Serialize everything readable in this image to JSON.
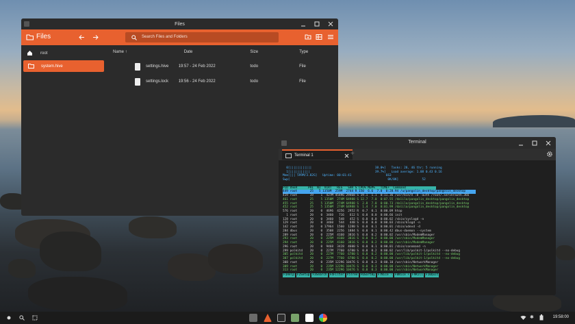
{
  "files": {
    "window_title": "Files",
    "app_title": "Files",
    "search_placeholder": "Search Files and Folders",
    "sidebar": [
      {
        "label": "root"
      },
      {
        "label": "system.hive"
      }
    ],
    "columns": {
      "name": "Name ↑",
      "date": "Date",
      "size": "Size",
      "type": "Type"
    },
    "rows": [
      {
        "name": "settings.hive",
        "date": "19:57 - 24 Feb 2022",
        "size": "todo",
        "type": "File"
      },
      {
        "name": "settings.lock",
        "date": "19:56 - 24 Feb 2022",
        "size": "todo",
        "type": "File"
      }
    ]
  },
  "terminal": {
    "window_title": "Terminal",
    "tab_label": "Terminal 1",
    "meters": [
      "  0[||||||||||||                                   38.0%]   Tasks: 28, 46 thr; 5 running",
      "  1[|||||||||||                                    39.7%]   Load average: 1.08 0.43 0.16",
      "Mem[||| 599M/3.82G]   Uptime: 00:01:41                   663   ",
      "Swp[                                                      0K/0K]             52"
    ],
    "header": "PID USER      PRI  NI  VIRT   RES   SHR S CPU% MEM%   TIME+  Command",
    "selected": "449 root       25   5 1350M  259M  2744 R 150  6.6  7.0  0:28.94 /u/pangolin_desktop/pangolin_desktop",
    "procs": [
      "419 root       19    1  427M 45496 29468 S 19.1  1.1  0:11.36 /usr/bin/X :0 -auth /root/.serverauth.366",
      "461 root       25    5 1350M  274M 64988 S 12.7  7.0  0:07.55 /dalila/pangolin_desktop/pangolin_desktop",
      "455 root       25    5 1350M  274M 64988 S  2.8  7.0  0:00.73 /dalila/pangolin_desktop/pangolin_desktop",
      "452 root       25    5 1350M  274M 64988 S  1.4  7.0  0:01.99 /dalila/pangolin_desktop/pangolin_desktop",
      "576 root       20    0  4696  4256  2952 R  0.7  0.1  0:00.09 htop",
      "  1 root       20    0  3460   716   612 S  0.0  0.0  0:00.66 init",
      "128 root       20    0  3460   548   452 S  0.0  0.0  0:00.02 /sbin/syslogd -n",
      "129 root       20    0  3460   544   448 S  0.0  0.0  0:00.03 /sbin/klogd -n",
      "142 root       20    0 17964  1560  1280 S  0.0  0.1  0:00.01 /sbin/udevd -d",
      "284 dbus       20    0  3508  2256  1884 S  0.0  0.1  0:00.42 dbus-daemon --system",
      "289 root       20    0  225M  4160  3816 S  0.0  0.2  0:00.02 /usr/sbin/ModemManager",
      "293 root       20    0  225M  4160  3816 S  0.0  0.2  0:00.00 /usr/sbin/ModemManager",
      "294 root       20    0  225M  4160  3816 S  0.0  0.2  0:00.00 /usr/sbin/ModemManager",
      "296 root       20    0  9468  3428  4600 S  0.0  0.1  0:00.01 /sbin/connmand -n",
      "299 polkitd    20    0  227M  7760  6780 S  0.0  0.2  0:00.02 /usr/lib/polkit-1/polkitd --no-debug",
      "305 polkitd    20    0  227M  7760  6780 S  0.0  0.2  0:00.00 /usr/lib/polkit-1/polkitd --no-debug",
      "307 polkitd    20    0  227M  7760  6780 S  0.0  0.2  0:00.00 /usr/lib/polkit-1/polkitd --no-debug",
      "308 root       20    0  235M 12296 10476 S  0.0  0.3  0:00.10 /usr/sbin/NetworkManager",
      "309 root       20    0  235M 12296 10476 S  0.0  0.3  0:00.00 /usr/sbin/NetworkManager",
      "313 root       20    0  235M 12296 10476 S  0.0  0.3  0:00.00 /usr/sbin/NetworkManager"
    ],
    "fkeys": [
      "F1Help",
      "F2Setup",
      "F3Search",
      "F4Filter",
      "F5Tree",
      "F6SortBy",
      "F7Nice -",
      "F8Nice +",
      "F9Kill",
      "F10Quit"
    ]
  },
  "taskbar": {
    "clock": "19:58:00"
  },
  "colors": {
    "accent": "#e8612f",
    "terminal_header": "#36b3a8",
    "selected_row": "#45a5ef"
  }
}
